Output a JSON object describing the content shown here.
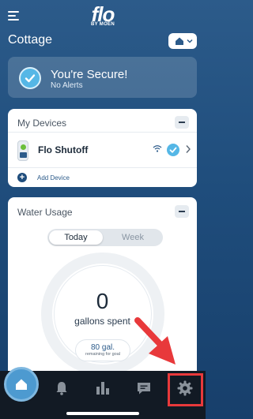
{
  "header": {
    "logo_text": "flo",
    "logo_subtext": "BY MOEN",
    "location": "Cottage"
  },
  "secure_banner": {
    "title": "You're Secure!",
    "subtitle": "No Alerts"
  },
  "devices_card": {
    "title": "My Devices",
    "device": {
      "name": "Flo Shutoff",
      "status": "online"
    },
    "add_label": "Add Device"
  },
  "water_card": {
    "title": "Water Usage",
    "tabs": [
      "Today",
      "Week"
    ],
    "selected_tab": "Today",
    "value": "0",
    "value_label": "gallons spent",
    "goal_value": "80 gal.",
    "goal_label": "remaining for goal"
  },
  "tabbar": {
    "items": [
      "home",
      "alerts",
      "usage",
      "messages",
      "settings"
    ],
    "active": "home",
    "highlighted": "settings"
  },
  "colors": {
    "background": "#1f4d7c",
    "accent": "#55b7e6",
    "highlight": "#e8393b"
  }
}
